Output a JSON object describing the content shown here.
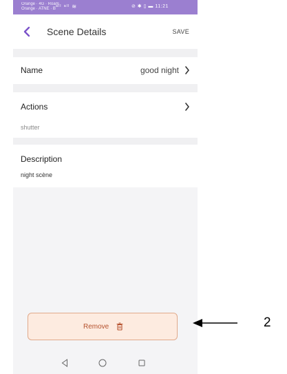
{
  "status_bar": {
    "carrier_line1": "Orange · 4G · Roam",
    "carrier_line2": "Orange · ATNE · B",
    "signal": "ᵃˡˡ ᵃˡˡ ≋",
    "right": "⊘ ✱ ▯ ▬ 11:21"
  },
  "header": {
    "title": "Scene Details",
    "save_label": "SAVE"
  },
  "name_row": {
    "label": "Name",
    "value": "good night"
  },
  "actions_row": {
    "label": "Actions",
    "item": "shutter"
  },
  "description_row": {
    "label": "Description",
    "value": "night scène"
  },
  "remove_button": {
    "label": "Remove"
  },
  "annotation": {
    "number": "2"
  },
  "colors": {
    "status_bar": "#9b7fd0",
    "accent": "#7b52c9",
    "remove_text": "#b5512d",
    "remove_bg": "#fdebe0",
    "remove_border": "#e0a98a"
  },
  "icons": [
    "back-chevron-icon",
    "chevron-right-icon",
    "trash-icon",
    "nav-back-icon",
    "nav-home-icon",
    "nav-recent-icon",
    "arrow-icon"
  ]
}
